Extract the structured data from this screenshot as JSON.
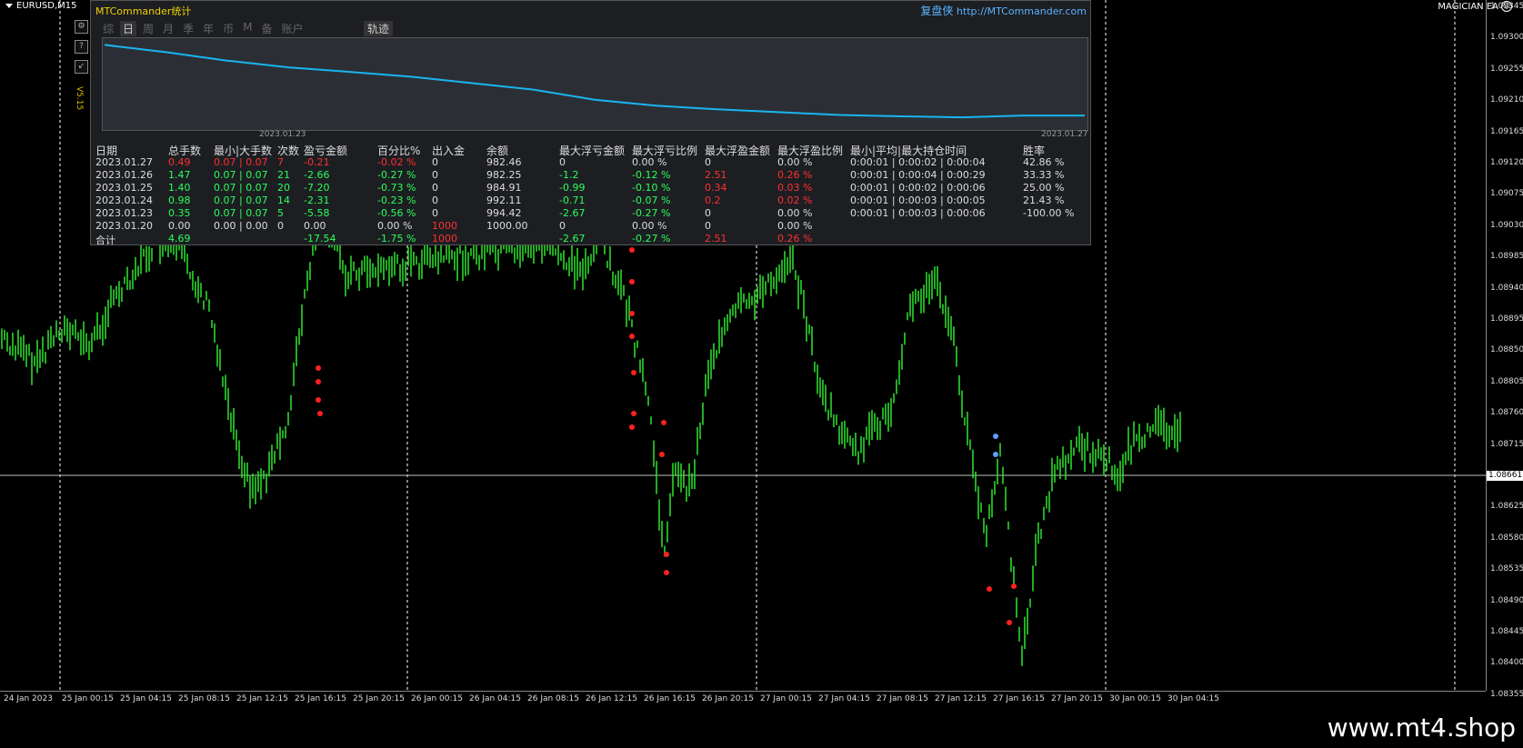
{
  "chart": {
    "symbol_label": "EURUSD,M15",
    "ea_label": "MAGICIAN EA",
    "current_price": "1.08661",
    "price_ticks": [
      "1.09345",
      "1.09300",
      "1.09255",
      "1.09210",
      "1.09165",
      "1.09120",
      "1.09075",
      "1.09030",
      "1.08985",
      "1.08940",
      "1.08895",
      "1.08850",
      "1.08805",
      "1.08760",
      "1.08715",
      "1.08670",
      "1.08625",
      "1.08580",
      "1.08535",
      "1.08490",
      "1.08445",
      "1.08400",
      "1.08355"
    ],
    "time_ticks": [
      "24 Jan 2023",
      "25 Jan 00:15",
      "25 Jan 04:15",
      "25 Jan 08:15",
      "25 Jan 12:15",
      "25 Jan 16:15",
      "25 Jan 20:15",
      "26 Jan 00:15",
      "26 Jan 04:15",
      "26 Jan 08:15",
      "26 Jan 12:15",
      "26 Jan 16:15",
      "26 Jan 20:15",
      "27 Jan 00:15",
      "27 Jan 04:15",
      "27 Jan 08:15",
      "27 Jan 12:15",
      "27 Jan 16:15",
      "27 Jan 20:15",
      "30 Jan 00:15",
      "30 Jan 04:15"
    ],
    "colors": {
      "candle": "#2bd82b",
      "grid": "#ffffff",
      "hline": "#c0c0c0",
      "sell_marker": "#ff2020",
      "buy_marker": "#5aa0ff"
    }
  },
  "side_icons": [
    "?",
    "?",
    "?"
  ],
  "version": "V5.15",
  "panel": {
    "title": "MTCommander统计",
    "link_zh": "复盘侠",
    "link_url": "http://MTCommander.com",
    "tabs": [
      "综",
      "日",
      "周",
      "月",
      "季",
      "年",
      "币",
      "M",
      "备",
      "账户"
    ],
    "active_tab": "日",
    "track_tab": "轨迹",
    "equity": {
      "start_date": "2023.01.23",
      "end_date": "2023.01.27",
      "line_color": "#1ab4f0",
      "values": [
        1000.0,
        998.2,
        996.1,
        994.42,
        993.3,
        992.11,
        990.5,
        988.9,
        986.4,
        984.91,
        984.0,
        983.3,
        982.6,
        982.25,
        982.0,
        982.46,
        982.46
      ]
    },
    "headers": [
      "日期",
      "总手数",
      "最小|大手数",
      "次数",
      "盈亏金额",
      "百分比%",
      "出入金",
      "余额",
      "最大浮亏金额",
      "最大浮亏比例",
      "最大浮盈金额",
      "最大浮盈比例",
      "最小|平均|最大持仓时间",
      "胜率"
    ],
    "rows": [
      {
        "c": [
          "2023.01.27",
          "0.49",
          "0.07 | 0.07",
          "7",
          "-0.21",
          "-0.02 %",
          "0",
          "982.46",
          "0",
          "0.00 %",
          "0",
          "0.00 %",
          "0:00:01 | 0:00:02 | 0:00:04",
          "42.86 %"
        ],
        "k": [
          "n",
          "r",
          "r",
          "r",
          "r",
          "r",
          "n",
          "n",
          "n",
          "n",
          "n",
          "n",
          "n",
          "n"
        ]
      },
      {
        "c": [
          "2023.01.26",
          "1.47",
          "0.07 | 0.07",
          "21",
          "-2.66",
          "-0.27 %",
          "0",
          "982.25",
          "-1.2",
          "-0.12 %",
          "2.51",
          "0.26 %",
          "0:00:01 | 0:00:04 | 0:00:29",
          "33.33 %"
        ],
        "k": [
          "n",
          "g",
          "g",
          "g",
          "g",
          "g",
          "n",
          "n",
          "g",
          "g",
          "r",
          "r",
          "n",
          "n"
        ]
      },
      {
        "c": [
          "2023.01.25",
          "1.40",
          "0.07 | 0.07",
          "20",
          "-7.20",
          "-0.73 %",
          "0",
          "984.91",
          "-0.99",
          "-0.10 %",
          "0.34",
          "0.03 %",
          "0:00:01 | 0:00:02 | 0:00:06",
          "25.00 %"
        ],
        "k": [
          "n",
          "g",
          "g",
          "g",
          "g",
          "g",
          "n",
          "n",
          "g",
          "g",
          "r",
          "r",
          "n",
          "n"
        ]
      },
      {
        "c": [
          "2023.01.24",
          "0.98",
          "0.07 | 0.07",
          "14",
          "-2.31",
          "-0.23 %",
          "0",
          "992.11",
          "-0.71",
          "-0.07 %",
          "0.2",
          "0.02 %",
          "0:00:01 | 0:00:03 | 0:00:05",
          "21.43 %"
        ],
        "k": [
          "n",
          "g",
          "g",
          "g",
          "g",
          "g",
          "n",
          "n",
          "g",
          "g",
          "r",
          "r",
          "n",
          "n"
        ]
      },
      {
        "c": [
          "2023.01.23",
          "0.35",
          "0.07 | 0.07",
          "5",
          "-5.58",
          "-0.56 %",
          "0",
          "994.42",
          "-2.67",
          "-0.27 %",
          "0",
          "0.00 %",
          "0:00:01 | 0:00:03 | 0:00:06",
          "-100.00 %"
        ],
        "k": [
          "n",
          "g",
          "g",
          "g",
          "g",
          "g",
          "n",
          "n",
          "g",
          "g",
          "n",
          "n",
          "n",
          "n"
        ]
      },
      {
        "c": [
          "2023.01.20",
          "0.00",
          "0.00 | 0.00",
          "0",
          "0.00",
          "0.00 %",
          "1000",
          "1000.00",
          "0",
          "0.00 %",
          "0",
          "0.00 %",
          "",
          ""
        ],
        "k": [
          "n",
          "n",
          "n",
          "n",
          "n",
          "n",
          "r",
          "n",
          "n",
          "n",
          "n",
          "n",
          "n",
          "n"
        ]
      },
      {
        "c": [
          "合计",
          "4.69",
          "",
          "",
          "-17.54",
          "-1.75 %",
          "1000",
          "",
          "-2.67",
          "-0.27 %",
          "2.51",
          "0.26 %",
          "",
          ""
        ],
        "k": [
          "n",
          "g",
          "n",
          "n",
          "g",
          "g",
          "r",
          "n",
          "g",
          "g",
          "r",
          "r",
          "n",
          "n"
        ]
      }
    ]
  },
  "watermark": "www.mt4.shop"
}
